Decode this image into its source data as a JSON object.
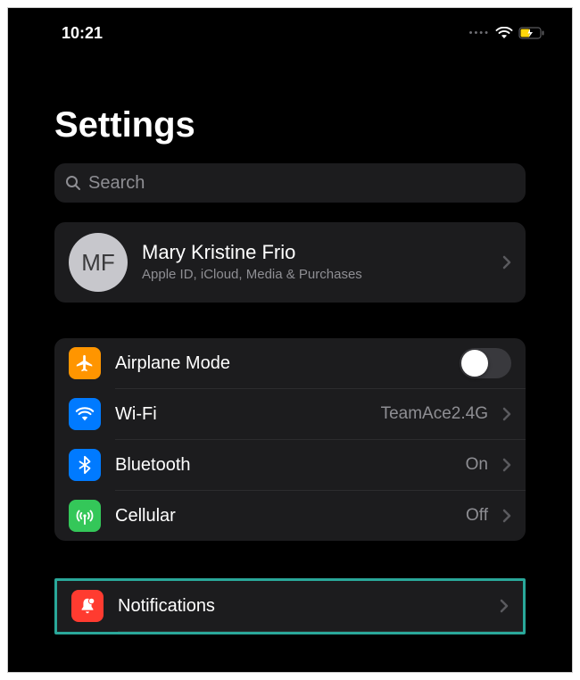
{
  "status_bar": {
    "time": "10:21"
  },
  "page": {
    "title": "Settings"
  },
  "search": {
    "placeholder": "Search"
  },
  "profile": {
    "initials": "MF",
    "name": "Mary Kristine Frio",
    "subtitle": "Apple ID, iCloud, Media & Purchases"
  },
  "group1": {
    "airplane": {
      "label": "Airplane Mode",
      "on": false
    },
    "wifi": {
      "label": "Wi-Fi",
      "value": "TeamAce2.4G"
    },
    "bluetooth": {
      "label": "Bluetooth",
      "value": "On"
    },
    "cellular": {
      "label": "Cellular",
      "value": "Off"
    }
  },
  "group2": {
    "notifications": {
      "label": "Notifications"
    }
  },
  "colors": {
    "highlight_border": "#2aa89a"
  }
}
